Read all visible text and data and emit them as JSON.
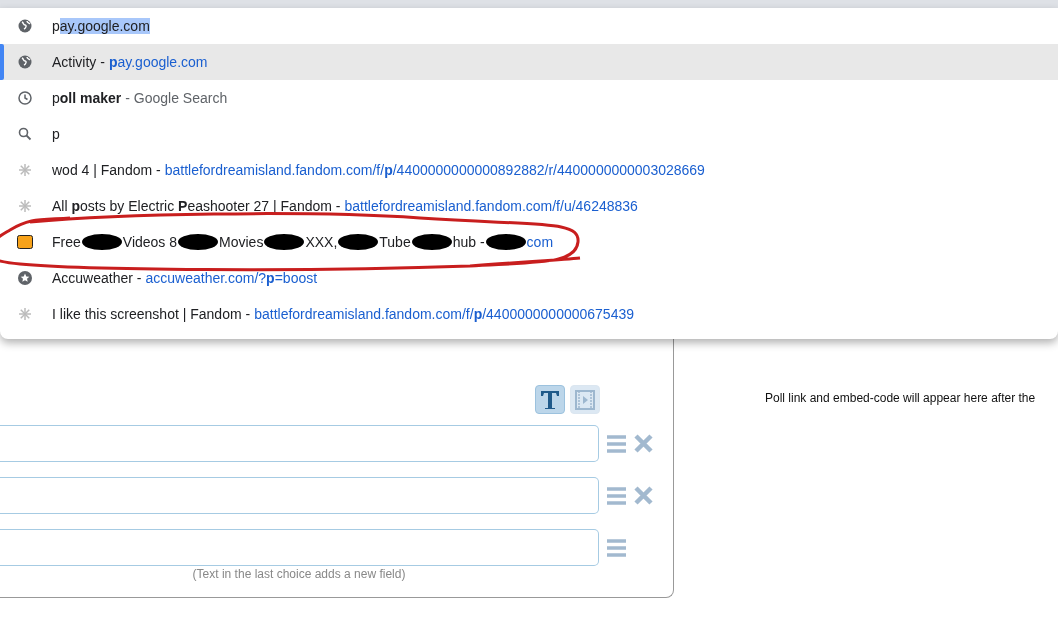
{
  "omnibox": {
    "typed": "p",
    "completion": "ay.google.com"
  },
  "suggestions": [
    {
      "kind": "site",
      "text": "Activity -",
      "url": "**p**ay.google.com",
      "selected": true
    },
    {
      "kind": "history",
      "text": "p**oll maker**",
      "suffix": "- Google Search",
      "selected": false
    },
    {
      "kind": "search",
      "text": "p",
      "selected": false
    },
    {
      "kind": "fandom",
      "text": "wod 4 | Fandom -",
      "url": "battlefordreamisland.fandom.com/f/**p**/4400000000000892882/r/4400000000003028669",
      "selected": false
    },
    {
      "kind": "fandom",
      "text": "All **p**osts by Electric **P**eashooter 27 | Fandom -",
      "url": "battlefordreamisland.fandom.com/f/u/46248836",
      "selected": false
    },
    {
      "kind": "redacted",
      "circled": true,
      "segments": [
        {
          "text": "Free",
          "link": false
        },
        {
          "text": "Videos 8",
          "link": false
        },
        {
          "text": "Movies",
          "link": false
        },
        {
          "text": "XXX,",
          "link": false
        },
        {
          "text": "Tube",
          "link": false
        },
        {
          "text": "hub -",
          "link": false
        },
        {
          "text": "com",
          "link": true
        }
      ],
      "selected": false
    },
    {
      "kind": "bookmark",
      "text": "Accuweather -",
      "url": "accuweather.com/?**p**=boost",
      "selected": false
    },
    {
      "kind": "fandom",
      "text": "I like this screenshot | Fandom -",
      "url": "battlefordreamisland.fandom.com/f/**p**/4400000000000675439",
      "selected": false
    }
  ],
  "poll": {
    "modes": [
      {
        "kind": "text",
        "selected": true
      },
      {
        "kind": "video",
        "selected": false
      }
    ],
    "choices": [
      {
        "removable": true
      },
      {
        "removable": true
      },
      {
        "removable": false
      }
    ],
    "hint": "(Text in the last choice adds a new field)"
  },
  "result_note": "Poll link and embed-code will appear here after the"
}
